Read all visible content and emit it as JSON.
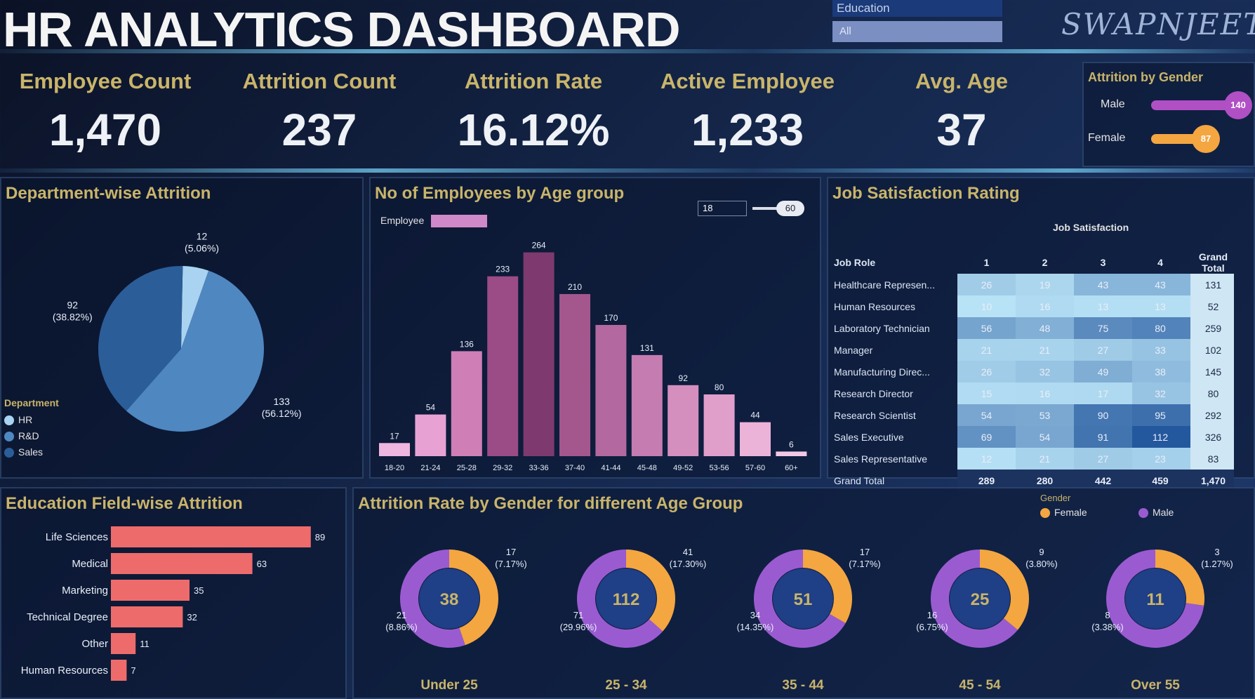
{
  "header": {
    "title": "HR ANALYTICS DASHBOARD",
    "education_slicer_label": "Education",
    "education_slicer_value": "All",
    "brand": "SWAPNJEET"
  },
  "kpis": [
    {
      "label": "Employee Count",
      "value": "1,470"
    },
    {
      "label": "Attrition Count",
      "value": "237"
    },
    {
      "label": "Attrition Rate",
      "value": "16.12%"
    },
    {
      "label": "Active Employee",
      "value": "1,233"
    },
    {
      "label": "Avg. Age",
      "value": "37"
    }
  ],
  "gender_panel": {
    "title": "Attrition by Gender",
    "items": [
      {
        "label": "Male",
        "value": "140",
        "color": "#b14fc5",
        "fraction": 0.59
      },
      {
        "label": "Female",
        "value": "87",
        "color": "#f4a641",
        "fraction": 0.37
      }
    ]
  },
  "department_panel": {
    "title": "Department-wise Attrition",
    "legend_title": "Department",
    "legend": [
      "HR",
      "R&D",
      "Sales"
    ],
    "chart_data": {
      "type": "pie",
      "categories": [
        "HR",
        "R&D",
        "Sales"
      ],
      "values": [
        12,
        133,
        92
      ],
      "labels": [
        "12\n(5.06%)",
        "133\n(56.12%)",
        "92\n(38.82%)"
      ],
      "colors": [
        "#a9d3f0",
        "#4f87c1",
        "#2b5d99"
      ]
    }
  },
  "age_panel": {
    "title": "No of Employees by Age group",
    "legend_label": "Employee",
    "slider_label": "Age slider",
    "slider_min": "18",
    "slider_max": "60",
    "chart_data": {
      "type": "bar",
      "categories": [
        "18-20",
        "21-24",
        "25-28",
        "29-32",
        "33-36",
        "37-40",
        "41-44",
        "45-48",
        "49-52",
        "53-56",
        "57-60",
        "60+"
      ],
      "values": [
        17,
        54,
        136,
        233,
        264,
        210,
        170,
        131,
        92,
        80,
        44,
        6
      ],
      "colors": [
        "#efb6df",
        "#e7a2d3",
        "#cf7fb6",
        "#9b4b85",
        "#7e3a6e",
        "#a3578d",
        "#b468a0",
        "#c57cb1",
        "#d48fbe",
        "#e09fcb",
        "#ecb3d9",
        "#f3c8e4"
      ],
      "ylim": [
        0,
        280
      ]
    }
  },
  "satisfaction_panel": {
    "title": "Job Satisfaction Rating",
    "column_group": "Job Satisfaction",
    "row_header": "Job Role",
    "columns": [
      "1",
      "2",
      "3",
      "4",
      "Grand Total"
    ],
    "rows": [
      {
        "role": "Healthcare Represen...",
        "values": [
          26,
          19,
          43,
          43
        ],
        "total": 131
      },
      {
        "role": "Human Resources",
        "values": [
          10,
          16,
          13,
          13
        ],
        "total": 52
      },
      {
        "role": "Laboratory Technician",
        "values": [
          56,
          48,
          75,
          80
        ],
        "total": 259
      },
      {
        "role": "Manager",
        "values": [
          21,
          21,
          27,
          33
        ],
        "total": 102
      },
      {
        "role": "Manufacturing Direc...",
        "values": [
          26,
          32,
          49,
          38
        ],
        "total": 145
      },
      {
        "role": "Research Director",
        "values": [
          15,
          16,
          17,
          32
        ],
        "total": 80
      },
      {
        "role": "Research Scientist",
        "values": [
          54,
          53,
          90,
          95
        ],
        "total": 292
      },
      {
        "role": "Sales Executive",
        "values": [
          69,
          54,
          91,
          112
        ],
        "total": 326
      },
      {
        "role": "Sales Representative",
        "values": [
          12,
          21,
          27,
          23
        ],
        "total": 83
      }
    ],
    "grand_total": {
      "label": "Grand Total",
      "values": [
        289,
        280,
        442,
        459
      ],
      "total": "1,470"
    }
  },
  "education_panel": {
    "title": "Education Field-wise Attrition",
    "chart_data": {
      "type": "bar",
      "orientation": "horizontal",
      "categories": [
        "Life Sciences",
        "Medical",
        "Marketing",
        "Technical Degree",
        "Other",
        "Human Resources"
      ],
      "values": [
        89,
        63,
        35,
        32,
        11,
        7
      ],
      "color": "#ee6b6b",
      "xlim": [
        0,
        100
      ]
    }
  },
  "gender_age_panel": {
    "title": "Attrition Rate by Gender for different Age Group",
    "legend_title": "Gender",
    "legend": [
      {
        "label": "Female",
        "color": "#f4a641"
      },
      {
        "label": "Male",
        "color": "#9a5bd1"
      }
    ],
    "chart_data": {
      "type": "pie",
      "variant": "donut",
      "groups": [
        {
          "category": "Under 25",
          "total": "38",
          "female": 17,
          "male": 21,
          "female_label": "17\n(7.17%)",
          "male_label": "21\n(8.86%)"
        },
        {
          "category": "25 - 34",
          "total": "112",
          "female": 41,
          "male": 71,
          "female_label": "41\n(17.30%)",
          "male_label": "71\n(29.96%)"
        },
        {
          "category": "35 - 44",
          "total": "51",
          "female": 17,
          "male": 34,
          "female_label": "17\n(7.17%)",
          "male_label": "34\n(14.35%)"
        },
        {
          "category": "45 - 54",
          "total": "25",
          "female": 9,
          "male": 16,
          "female_label": "9\n(3.80%)",
          "male_label": "16\n(6.75%)"
        },
        {
          "category": "Over 55",
          "total": "11",
          "female": 3,
          "male": 8,
          "female_label": "3\n(1.27%)",
          "male_label": "8\n(3.38%)"
        }
      ]
    }
  }
}
